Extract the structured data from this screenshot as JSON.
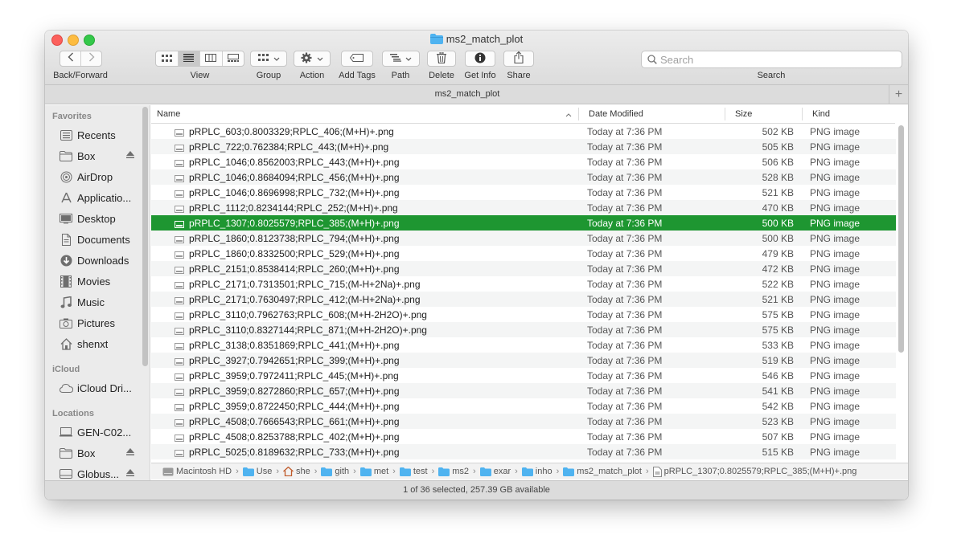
{
  "window": {
    "title": "ms2_match_plot",
    "tab_title": "ms2_match_plot"
  },
  "toolbar": {
    "back_forward_label": "Back/Forward",
    "view_label": "View",
    "group_label": "Group",
    "action_label": "Action",
    "add_tags_label": "Add Tags",
    "path_label": "Path",
    "delete_label": "Delete",
    "get_info_label": "Get Info",
    "share_label": "Share",
    "search_label": "Search",
    "search_placeholder": "Search"
  },
  "sidebar": {
    "favorites_header": "Favorites",
    "favorites": [
      {
        "label": "Recents",
        "icon": "recents-icon"
      },
      {
        "label": "Box",
        "icon": "folder-icon",
        "eject": true
      },
      {
        "label": "AirDrop",
        "icon": "airdrop-icon"
      },
      {
        "label": "Applicatio...",
        "icon": "applications-icon"
      },
      {
        "label": "Desktop",
        "icon": "desktop-icon"
      },
      {
        "label": "Documents",
        "icon": "documents-icon"
      },
      {
        "label": "Downloads",
        "icon": "downloads-icon"
      },
      {
        "label": "Movies",
        "icon": "movies-icon"
      },
      {
        "label": "Music",
        "icon": "music-icon"
      },
      {
        "label": "Pictures",
        "icon": "pictures-icon"
      },
      {
        "label": "shenxt",
        "icon": "home-icon"
      }
    ],
    "icloud_header": "iCloud",
    "icloud": [
      {
        "label": "iCloud Dri...",
        "icon": "cloud-icon"
      }
    ],
    "locations_header": "Locations",
    "locations": [
      {
        "label": "GEN-C02...",
        "icon": "computer-icon"
      },
      {
        "label": "Box",
        "icon": "folder-icon",
        "eject": true
      },
      {
        "label": "Globus...",
        "icon": "disk-icon",
        "eject": true
      }
    ]
  },
  "columns": {
    "name": "Name",
    "date": "Date Modified",
    "size": "Size",
    "kind": "Kind"
  },
  "files": [
    {
      "name": "pRPLC_603;0.8003329;RPLC_406;(M+H)+.png",
      "date": "Today at 7:36 PM",
      "size": "502 KB",
      "kind": "PNG image"
    },
    {
      "name": "pRPLC_722;0.762384;RPLC_443;(M+H)+.png",
      "date": "Today at 7:36 PM",
      "size": "505 KB",
      "kind": "PNG image"
    },
    {
      "name": "pRPLC_1046;0.8562003;RPLC_443;(M+H)+.png",
      "date": "Today at 7:36 PM",
      "size": "506 KB",
      "kind": "PNG image"
    },
    {
      "name": "pRPLC_1046;0.8684094;RPLC_456;(M+H)+.png",
      "date": "Today at 7:36 PM",
      "size": "528 KB",
      "kind": "PNG image"
    },
    {
      "name": "pRPLC_1046;0.8696998;RPLC_732;(M+H)+.png",
      "date": "Today at 7:36 PM",
      "size": "521 KB",
      "kind": "PNG image"
    },
    {
      "name": "pRPLC_1112;0.8234144;RPLC_252;(M+H)+.png",
      "date": "Today at 7:36 PM",
      "size": "470 KB",
      "kind": "PNG image"
    },
    {
      "name": "pRPLC_1307;0.8025579;RPLC_385;(M+H)+.png",
      "date": "Today at 7:36 PM",
      "size": "500 KB",
      "kind": "PNG image",
      "selected": true
    },
    {
      "name": "pRPLC_1860;0.8123738;RPLC_794;(M+H)+.png",
      "date": "Today at 7:36 PM",
      "size": "500 KB",
      "kind": "PNG image"
    },
    {
      "name": "pRPLC_1860;0.8332500;RPLC_529;(M+H)+.png",
      "date": "Today at 7:36 PM",
      "size": "479 KB",
      "kind": "PNG image"
    },
    {
      "name": "pRPLC_2151;0.8538414;RPLC_260;(M+H)+.png",
      "date": "Today at 7:36 PM",
      "size": "472 KB",
      "kind": "PNG image"
    },
    {
      "name": "pRPLC_2171;0.7313501;RPLC_715;(M-H+2Na)+.png",
      "date": "Today at 7:36 PM",
      "size": "522 KB",
      "kind": "PNG image"
    },
    {
      "name": "pRPLC_2171;0.7630497;RPLC_412;(M-H+2Na)+.png",
      "date": "Today at 7:36 PM",
      "size": "521 KB",
      "kind": "PNG image"
    },
    {
      "name": "pRPLC_3110;0.7962763;RPLC_608;(M+H-2H2O)+.png",
      "date": "Today at 7:36 PM",
      "size": "575 KB",
      "kind": "PNG image"
    },
    {
      "name": "pRPLC_3110;0.8327144;RPLC_871;(M+H-2H2O)+.png",
      "date": "Today at 7:36 PM",
      "size": "575 KB",
      "kind": "PNG image"
    },
    {
      "name": "pRPLC_3138;0.8351869;RPLC_441;(M+H)+.png",
      "date": "Today at 7:36 PM",
      "size": "533 KB",
      "kind": "PNG image"
    },
    {
      "name": "pRPLC_3927;0.7942651;RPLC_399;(M+H)+.png",
      "date": "Today at 7:36 PM",
      "size": "519 KB",
      "kind": "PNG image"
    },
    {
      "name": "pRPLC_3959;0.7972411;RPLC_445;(M+H)+.png",
      "date": "Today at 7:36 PM",
      "size": "546 KB",
      "kind": "PNG image"
    },
    {
      "name": "pRPLC_3959;0.8272860;RPLC_657;(M+H)+.png",
      "date": "Today at 7:36 PM",
      "size": "541 KB",
      "kind": "PNG image"
    },
    {
      "name": "pRPLC_3959;0.8722450;RPLC_444;(M+H)+.png",
      "date": "Today at 7:36 PM",
      "size": "542 KB",
      "kind": "PNG image"
    },
    {
      "name": "pRPLC_4508;0.7666543;RPLC_661;(M+H)+.png",
      "date": "Today at 7:36 PM",
      "size": "523 KB",
      "kind": "PNG image"
    },
    {
      "name": "pRPLC_4508;0.8253788;RPLC_402;(M+H)+.png",
      "date": "Today at 7:36 PM",
      "size": "507 KB",
      "kind": "PNG image"
    },
    {
      "name": "pRPLC_5025;0.8189632;RPLC_733;(M+H)+.png",
      "date": "Today at 7:36 PM",
      "size": "515 KB",
      "kind": "PNG image"
    }
  ],
  "pathbar": [
    {
      "label": "Macintosh HD",
      "icon": "hard-drive-icon"
    },
    {
      "label": "Use",
      "icon": "folder-icon"
    },
    {
      "label": "she",
      "icon": "home-icon"
    },
    {
      "label": "gith",
      "icon": "folder-icon"
    },
    {
      "label": "met",
      "icon": "folder-icon"
    },
    {
      "label": "test",
      "icon": "folder-icon"
    },
    {
      "label": "ms2",
      "icon": "folder-icon"
    },
    {
      "label": "exar",
      "icon": "folder-icon"
    },
    {
      "label": "inho",
      "icon": "folder-icon"
    },
    {
      "label": "ms2_match_plot",
      "icon": "folder-icon"
    },
    {
      "label": "pRPLC_1307;0.8025579;RPLC_385;(M+H)+.png",
      "icon": "file-icon"
    }
  ],
  "status": {
    "text": "1 of 36 selected, 257.39 GB available"
  },
  "colors": {
    "selection": "#1e9631",
    "folder": "#4fb3f0"
  }
}
